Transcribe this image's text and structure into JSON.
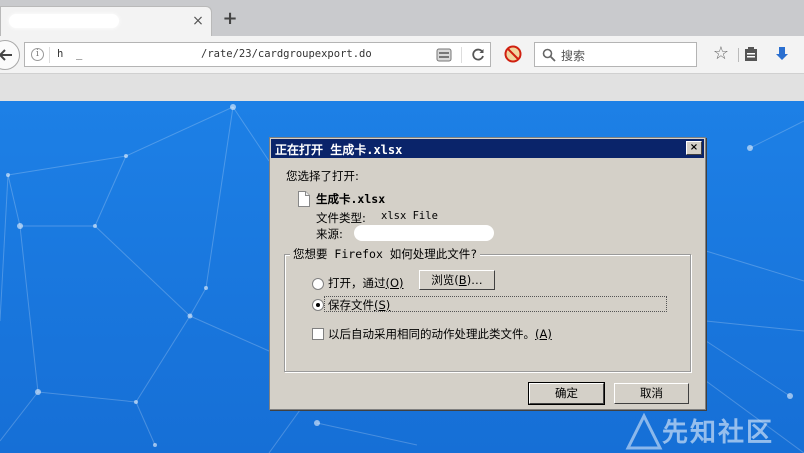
{
  "browser": {
    "tab_close_glyph": "×",
    "new_tab_glyph": "+",
    "url_prefix": "h  _",
    "url_path": "/rate/23/cardgroupexport.do",
    "search_placeholder": "搜索"
  },
  "dialog": {
    "title": "正在打开 生成卡.xlsx",
    "close_glyph": "×",
    "intro": "您选择了打开:",
    "file_name": "生成卡.xlsx",
    "file_type_label": "文件类型:",
    "file_type_value": "xlsx File",
    "source_label": "来源:",
    "question": "您想要 Firefox 如何处理此文件?",
    "open_with_label": "打开，通过",
    "open_with_key": "(O)",
    "browse_label": "浏览(",
    "browse_key": "B",
    "browse_suffix": ")…",
    "save_label": "保存文件",
    "save_key": "(S)",
    "auto_label": "以后自动采用相同的动作处理此类文件。",
    "auto_key": "(A)",
    "ok_label": "确定",
    "cancel_label": "取消",
    "save_selected": true,
    "auto_checked": false
  },
  "watermark": {
    "text": "先知社区"
  }
}
